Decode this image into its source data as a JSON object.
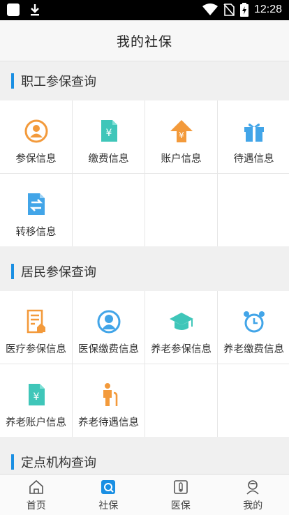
{
  "status_bar": {
    "time": "12:28",
    "icons": [
      "notification-square-icon",
      "download-icon",
      "wifi-icon",
      "no-sim-icon",
      "battery-icon"
    ]
  },
  "app_bar": {
    "title": "我的社保"
  },
  "sections": [
    {
      "title": "职工参保查询",
      "items": [
        {
          "label": "参保信息",
          "icon": "person-circle-icon"
        },
        {
          "label": "缴费信息",
          "icon": "yuan-document-icon"
        },
        {
          "label": "账户信息",
          "icon": "yuan-arrow-up-icon"
        },
        {
          "label": "待遇信息",
          "icon": "gift-icon"
        },
        {
          "label": "转移信息",
          "icon": "transfer-document-icon"
        }
      ]
    },
    {
      "title": "居民参保查询",
      "items": [
        {
          "label": "医疗参保信息",
          "icon": "medical-form-icon"
        },
        {
          "label": "医保缴费信息",
          "icon": "person-avatar-icon"
        },
        {
          "label": "养老参保信息",
          "icon": "graduation-cap-icon"
        },
        {
          "label": "养老缴费信息",
          "icon": "alarm-clock-icon"
        },
        {
          "label": "养老账户信息",
          "icon": "yuan-document-icon"
        },
        {
          "label": "养老待遇信息",
          "icon": "elderly-person-icon"
        }
      ]
    },
    {
      "title": "定点机构查询",
      "items": []
    }
  ],
  "tab_bar": {
    "tabs": [
      {
        "label": "首页",
        "icon": "home-icon",
        "active": false
      },
      {
        "label": "社保",
        "icon": "social-security-icon",
        "active": true
      },
      {
        "label": "医保",
        "icon": "medical-card-icon",
        "active": false
      },
      {
        "label": "我的",
        "icon": "user-icon",
        "active": false
      }
    ]
  },
  "colors": {
    "accent": "#1a8fe3",
    "orange": "#f39a3b",
    "teal": "#3fc6b9",
    "blue": "#42a5e8"
  }
}
